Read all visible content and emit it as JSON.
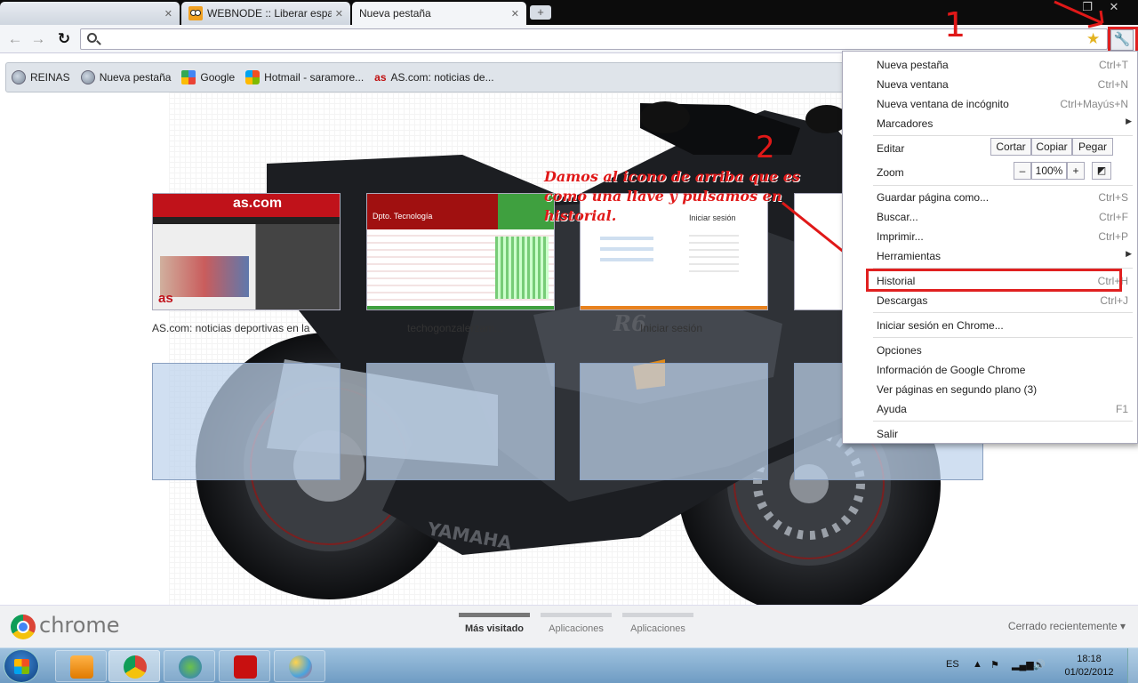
{
  "tabs": [
    {
      "title": ""
    },
    {
      "title": "WEBNODE :: Liberar espacio"
    },
    {
      "title": "Nueva pestaña"
    }
  ],
  "bookmarks": [
    {
      "label": "REINAS",
      "icon": "globe-icon"
    },
    {
      "label": "Nueva pestaña",
      "icon": "globe-icon"
    },
    {
      "label": "Google",
      "icon": "google-icon"
    },
    {
      "label": "Hotmail - saramore...",
      "icon": "msn-icon"
    },
    {
      "label": "AS.com: noticias de...",
      "icon": "as-icon",
      "icon_text": "as"
    }
  ],
  "thumbnails": [
    {
      "caption": "AS.com: noticias deportivas en la"
    },
    {
      "caption": "techogonzalerzam...",
      "header": "Dpto. Tecnología"
    },
    {
      "caption": "Iniciar sesión",
      "header": "Iniciar sesión"
    },
    {
      "caption": ""
    }
  ],
  "annotation": {
    "num1": "1",
    "num2": "2",
    "text": "Damos al icono de arriba que es como una llave y pulsamos en historial."
  },
  "menu": {
    "items": [
      {
        "label": "Nueva pestaña",
        "shortcut": "Ctrl+T"
      },
      {
        "label": "Nueva ventana",
        "shortcut": "Ctrl+N"
      },
      {
        "label": "Nueva ventana de incógnito",
        "shortcut": "Ctrl+Mayús+N"
      },
      {
        "label": "Marcadores",
        "shortcut": "▶"
      },
      {
        "label": "Editar",
        "shortcut": ""
      },
      {
        "label": "Zoom",
        "shortcut": ""
      },
      {
        "label": "Guardar página como...",
        "shortcut": "Ctrl+S"
      },
      {
        "label": "Buscar...",
        "shortcut": "Ctrl+F"
      },
      {
        "label": "Imprimir...",
        "shortcut": "Ctrl+P"
      },
      {
        "label": "Herramientas",
        "shortcut": "▶"
      },
      {
        "label": "Historial",
        "shortcut": "Ctrl+H"
      },
      {
        "label": "Descargas",
        "shortcut": "Ctrl+J"
      },
      {
        "label": "Iniciar sesión en Chrome...",
        "shortcut": ""
      },
      {
        "label": "Opciones",
        "shortcut": ""
      },
      {
        "label": "Información de Google Chrome",
        "shortcut": ""
      },
      {
        "label": "Ver páginas en segundo plano (3)",
        "shortcut": ""
      },
      {
        "label": "Ayuda",
        "shortcut": "F1"
      },
      {
        "label": "Salir",
        "shortcut": ""
      }
    ],
    "edit_buttons": [
      "Cortar",
      "Copiar",
      "Pegar"
    ],
    "zoom": {
      "minus": "–",
      "value": "100%",
      "plus": "+"
    }
  },
  "footer": {
    "logo_text": "chrome",
    "tabs": [
      "Más visitado",
      "Aplicaciones",
      "Aplicaciones"
    ],
    "recent": "Cerrado recientemente ▾"
  },
  "taskbar": {
    "lang": "ES",
    "time": "18:18",
    "date": "01/02/2012"
  },
  "colors": {
    "annotation_red": "#e01818",
    "highlight_red": "#e02020"
  }
}
